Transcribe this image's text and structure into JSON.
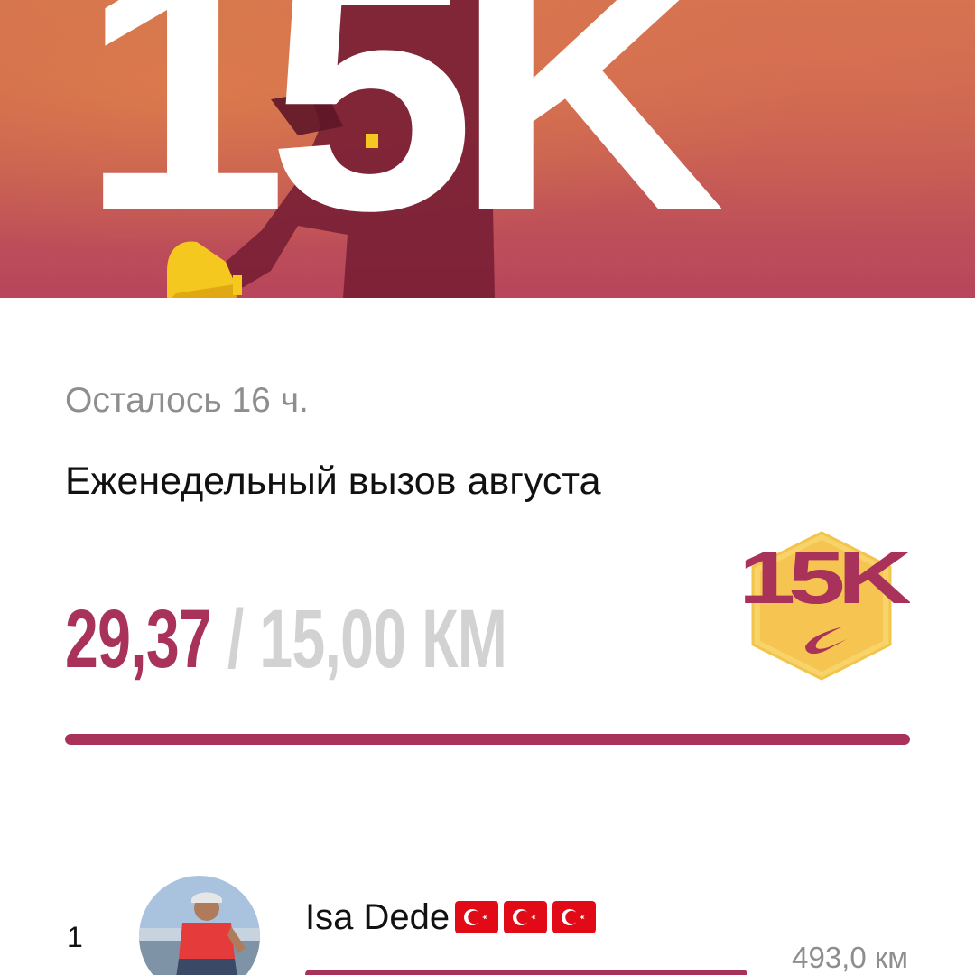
{
  "hero": {
    "title": "15K"
  },
  "challenge": {
    "time_left": "Осталось 16 ч.",
    "title": "Еженедельный вызов августа",
    "progress": {
      "current": "29,37",
      "separator": "/",
      "goal": "15,00",
      "unit": "КМ",
      "fraction": 1.0
    },
    "badge": {
      "text": "15K",
      "logo": "swoosh-icon"
    }
  },
  "leaderboard": {
    "entries": [
      {
        "rank": "1",
        "name": "Isa Dede",
        "flags": [
          "turkey-flag-icon",
          "turkey-flag-icon",
          "turkey-flag-icon"
        ],
        "distance": "493,0 км",
        "fraction": 1.0
      }
    ]
  },
  "colors": {
    "accent": "#a8325a",
    "muted": "#8e8e8e",
    "light_muted": "#d2d2d2",
    "badge_fill": "#f5c451"
  }
}
